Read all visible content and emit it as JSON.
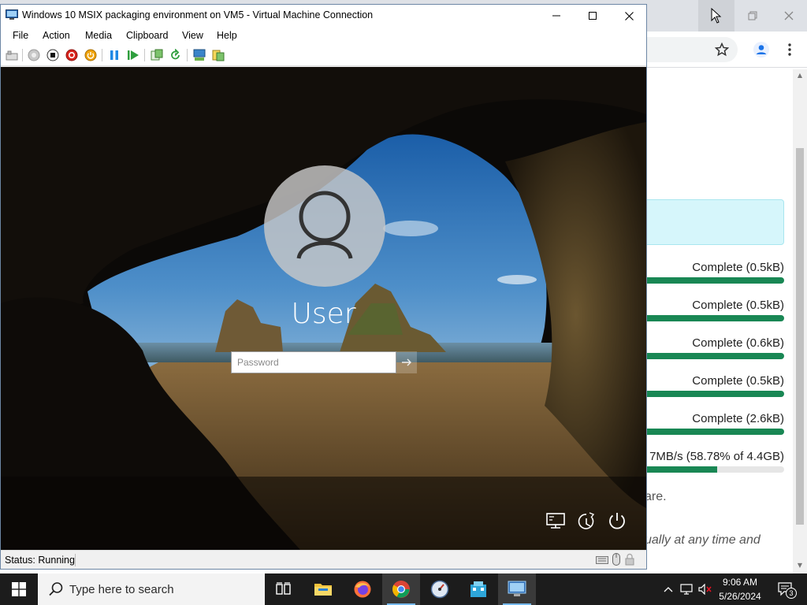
{
  "browser": {
    "downloads": [
      {
        "status": "Complete (0.5kB)",
        "progress": 1.0
      },
      {
        "status": "Complete (0.5kB)",
        "progress": 1.0
      },
      {
        "status": "Complete (0.6kB)",
        "progress": 1.0
      },
      {
        "status": "Complete (0.5kB)",
        "progress": 1.0
      },
      {
        "status": "Complete (2.6kB)",
        "progress": 1.0
      },
      {
        "status": "7MB/s (58.78% of 4.4GB)",
        "progress": 0.5878
      }
    ],
    "text_fragment_1": "are.",
    "text_fragment_2": "ually at any time and"
  },
  "vm": {
    "title": "Windows 10 MSIX packaging environment on VM5 - Virtual Machine Connection",
    "menu": [
      "File",
      "Action",
      "Media",
      "Clipboard",
      "View",
      "Help"
    ],
    "user_name": "User",
    "password_placeholder": "Password",
    "status": "Status: Running"
  },
  "taskbar": {
    "search_placeholder": "Type here to search",
    "time": "9:06 AM",
    "date": "5/26/2024",
    "notification_count": "3",
    "accent": "#76b9ed"
  },
  "colors": {
    "progress_fill": "#198754",
    "notice_bg": "#d6f6fb"
  }
}
